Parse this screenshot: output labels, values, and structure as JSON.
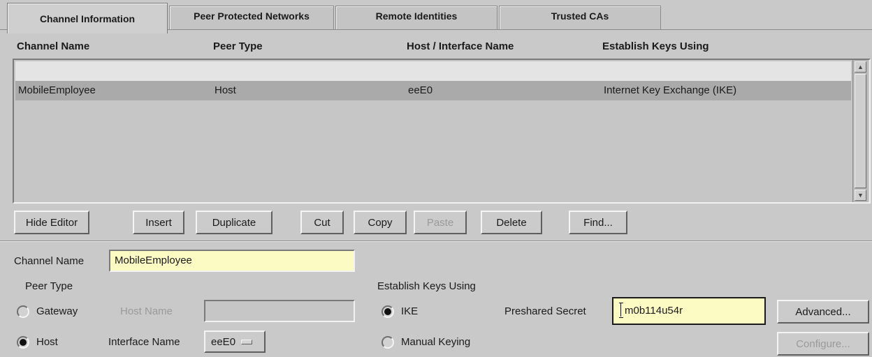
{
  "tabs": [
    {
      "label": "Channel Information",
      "active": true
    },
    {
      "label": "Peer Protected Networks",
      "active": false
    },
    {
      "label": "Remote Identities",
      "active": false
    },
    {
      "label": "Trusted CAs",
      "active": false
    }
  ],
  "table": {
    "columns": [
      "Channel Name",
      "Peer Type",
      "Host / Interface Name",
      "Establish Keys Using"
    ],
    "rows": [
      {
        "channel_name": "",
        "peer_type": "",
        "host_interface": "",
        "establish_keys": ""
      },
      {
        "channel_name": "MobileEmployee",
        "peer_type": "Host",
        "host_interface": "eeE0",
        "establish_keys": "Internet Key Exchange (IKE)"
      }
    ],
    "selected_row": 1
  },
  "toolbar": {
    "hide_editor": "Hide Editor",
    "insert": "Insert",
    "duplicate": "Duplicate",
    "cut": "Cut",
    "copy": "Copy",
    "paste": "Paste",
    "delete": "Delete",
    "find": "Find..."
  },
  "editor": {
    "channel_name_label": "Channel Name",
    "channel_name_value": "MobileEmployee",
    "peer_type_label": "Peer Type",
    "gateway_label": "Gateway",
    "host_name_label": "Host Name",
    "host_name_value": "",
    "host_label": "Host",
    "interface_name_label": "Interface Name",
    "interface_name_value": "eeE0",
    "peer_type_selected": "Host",
    "establish_keys_label": "Establish Keys Using",
    "ike_label": "IKE",
    "manual_keying_label": "Manual Keying",
    "keys_selected": "IKE",
    "preshared_secret_label": "Preshared Secret",
    "preshared_secret_value": "m0b114u54r",
    "advanced_button": "Advanced...",
    "configure_button": "Configure..."
  }
}
